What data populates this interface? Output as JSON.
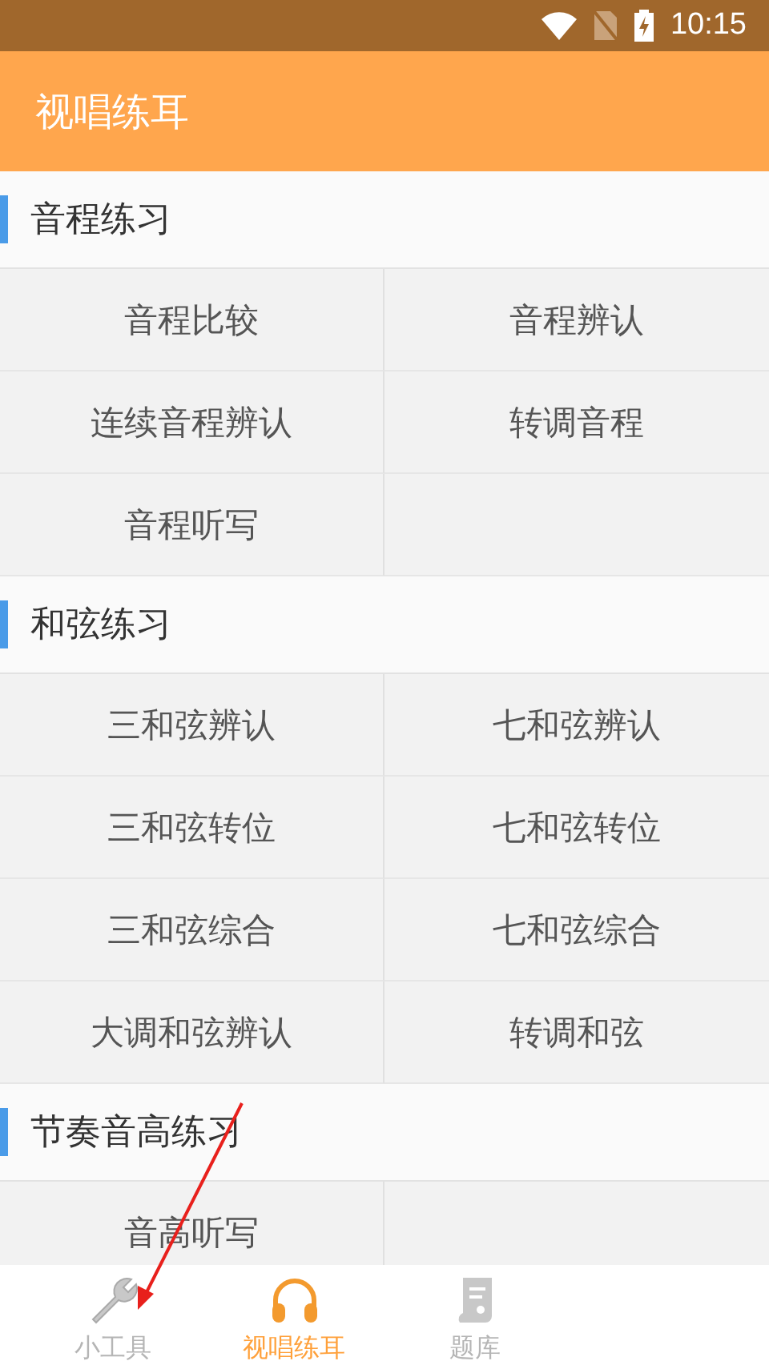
{
  "status_bar": {
    "time": "10:15"
  },
  "app_bar": {
    "title": "视唱练耳"
  },
  "sections": [
    {
      "title": "音程练习",
      "items": [
        "音程比较",
        "音程辨认",
        "连续音程辨认",
        "转调音程",
        "音程听写"
      ]
    },
    {
      "title": "和弦练习",
      "items": [
        "三和弦辨认",
        "七和弦辨认",
        "三和弦转位",
        "七和弦转位",
        "三和弦综合",
        "七和弦综合",
        "大调和弦辨认",
        "转调和弦"
      ]
    },
    {
      "title": "节奏音高练习",
      "items": [
        "音高听写"
      ]
    }
  ],
  "bottom_nav": [
    {
      "label": "小工具",
      "kind": "wrench",
      "selected": false
    },
    {
      "label": "视唱练耳",
      "kind": "headphones",
      "selected": true
    },
    {
      "label": "题库",
      "kind": "scroll",
      "selected": false
    }
  ]
}
